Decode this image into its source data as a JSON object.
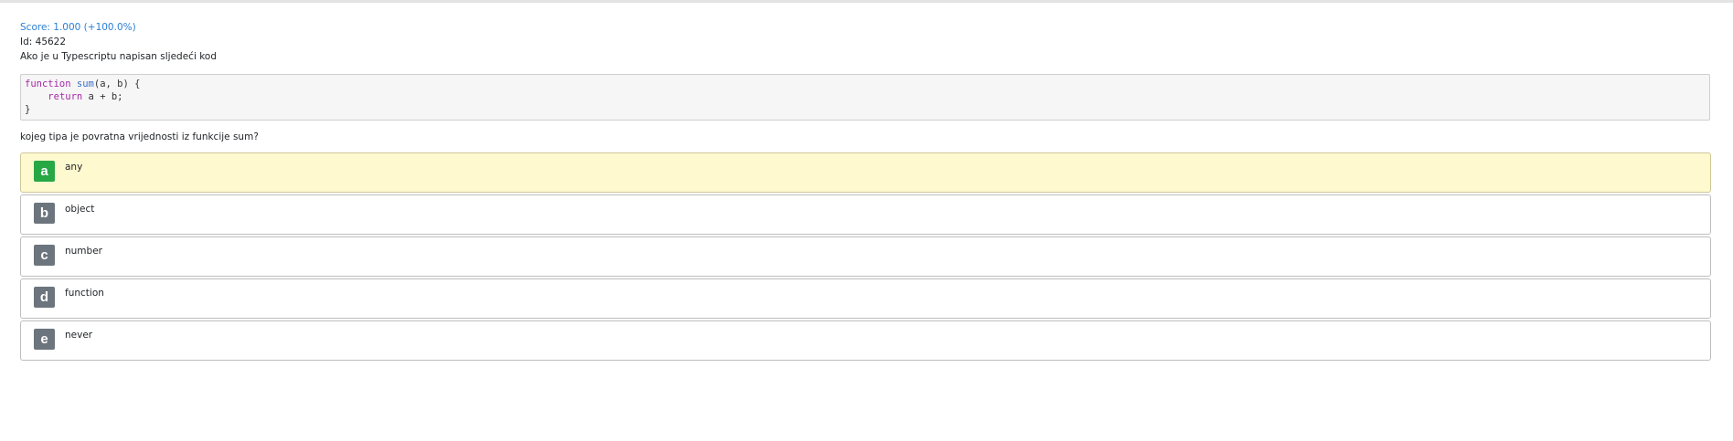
{
  "score": "Score: 1.000 (+100.0%)",
  "question_id": "Id: 45622",
  "intro": "Ako je u Typescriptu napisan sljedeći kod",
  "code": {
    "line1_kw": "function",
    "line1_fn": "sum",
    "line1_rest": "(a, b) {",
    "line2_indent": "    ",
    "line2_kw": "return",
    "line2_rest": " a + b;",
    "line3": "}"
  },
  "sub_question": "kojeg tipa je povratna vrijednosti iz funkcije sum?",
  "answers": [
    {
      "letter": "a",
      "text": "any",
      "selected": true,
      "correct": true
    },
    {
      "letter": "b",
      "text": "object",
      "selected": false,
      "correct": false
    },
    {
      "letter": "c",
      "text": "number",
      "selected": false,
      "correct": false
    },
    {
      "letter": "d",
      "text": "function",
      "selected": false,
      "correct": false
    },
    {
      "letter": "e",
      "text": "never",
      "selected": false,
      "correct": false
    }
  ],
  "colors": {
    "score": "#2b7fd6",
    "selected_bg": "#fff9cf",
    "correct_badge": "#28a745",
    "default_badge": "#6c757d"
  }
}
